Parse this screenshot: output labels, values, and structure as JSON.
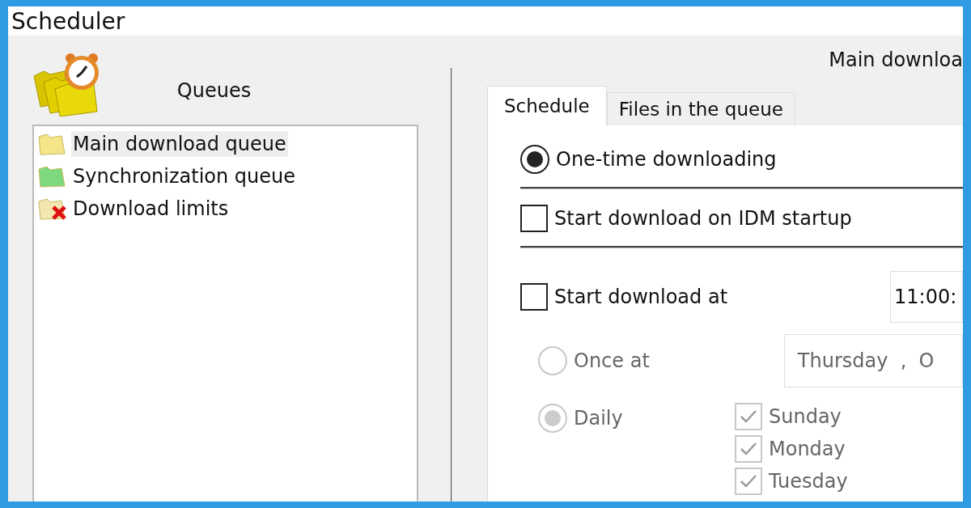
{
  "window": {
    "title": "Scheduler"
  },
  "queues_panel": {
    "heading": "Queues",
    "items": [
      {
        "label": "Main download queue",
        "kind": "main",
        "selected": true
      },
      {
        "label": "Synchronization queue",
        "kind": "sync",
        "selected": false
      },
      {
        "label": "Download limits",
        "kind": "limits",
        "selected": false
      }
    ]
  },
  "queue_name": "Main downloa",
  "tabs": [
    {
      "label": "Schedule",
      "selected": true
    },
    {
      "label": "Files in the queue",
      "selected": false
    }
  ],
  "schedule": {
    "one_time": {
      "label": "One-time downloading",
      "checked": true
    },
    "on_startup": {
      "label": "Start download on IDM startup",
      "checked": false
    },
    "start_at": {
      "label": "Start download at",
      "checked": false,
      "time": "11:00:"
    },
    "once_at": {
      "label": "Once at",
      "selected": false,
      "disabled": true,
      "date": "Thursday  ,  O"
    },
    "daily": {
      "label": "Daily",
      "selected": true,
      "disabled": true
    },
    "days": [
      {
        "label": "Sunday",
        "checked": true,
        "disabled": true
      },
      {
        "label": "Monday",
        "checked": true,
        "disabled": true
      },
      {
        "label": "Tuesday",
        "checked": true,
        "disabled": true
      }
    ]
  }
}
